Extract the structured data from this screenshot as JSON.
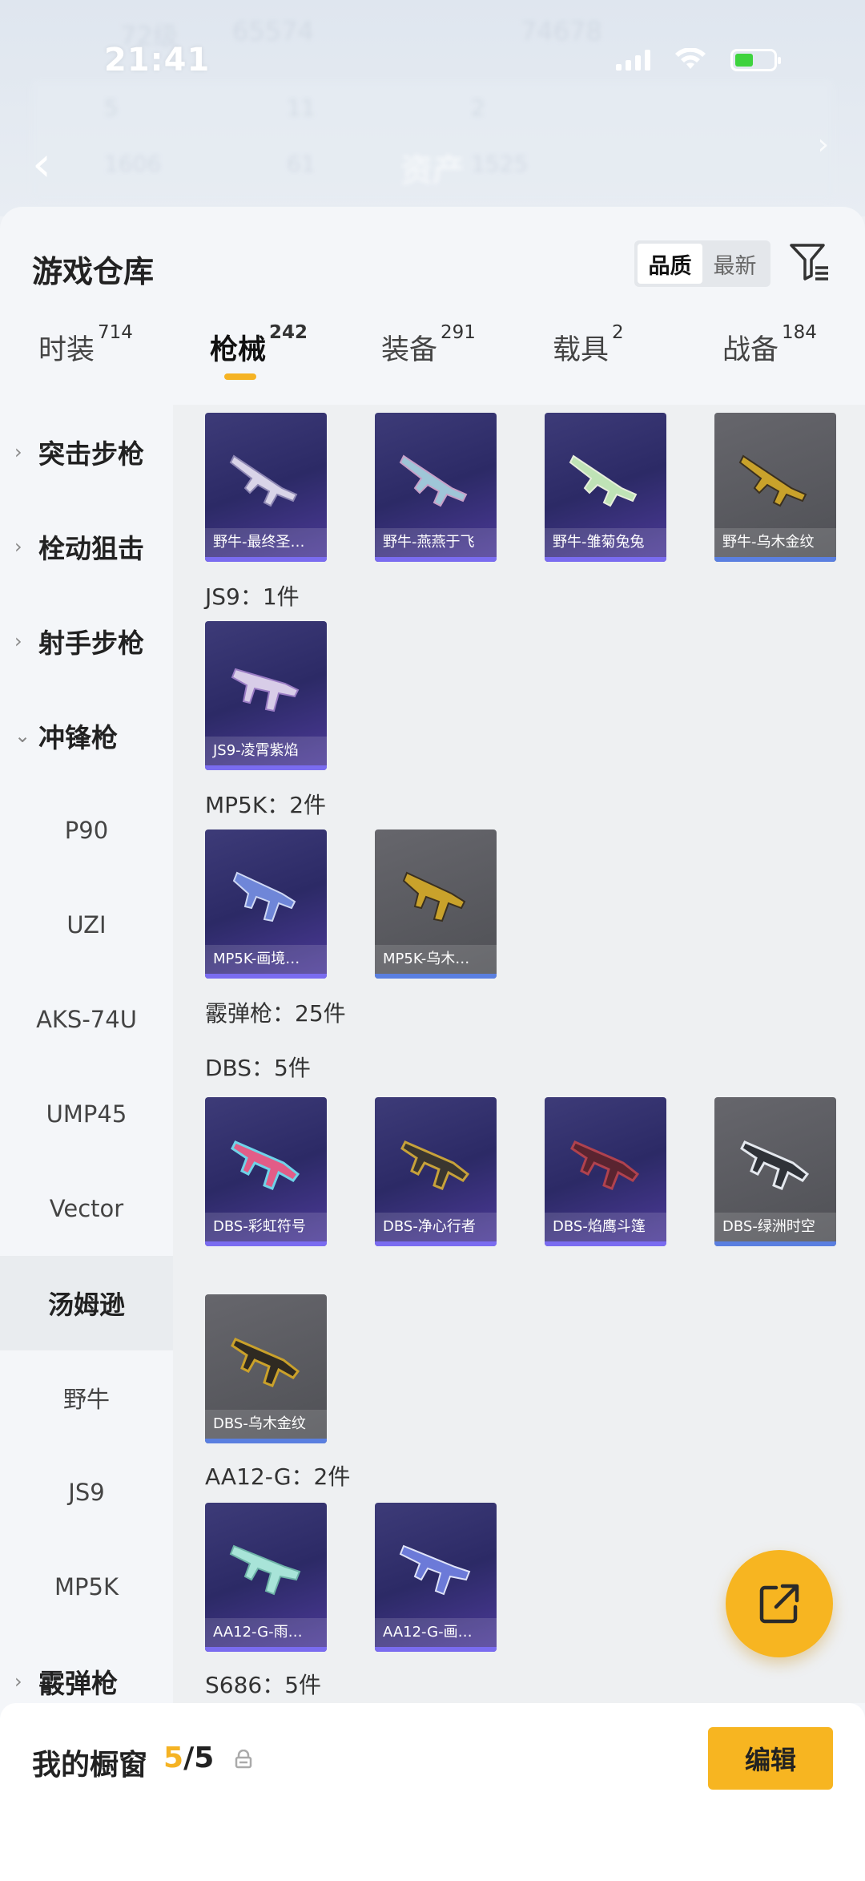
{
  "status_bar": {
    "time": "21:41"
  },
  "background": {
    "player_level": "72级",
    "score_1": "65574",
    "score_2": "74678",
    "stats": [
      "5",
      "11",
      "2",
      "1606",
      "61",
      "1525"
    ],
    "asset_label": "资产"
  },
  "sheet": {
    "title": "游戏仓库",
    "sort": {
      "options": [
        "品质",
        "最新"
      ],
      "active": "品质"
    }
  },
  "tabs": [
    {
      "label": "时装",
      "count": "714"
    },
    {
      "label": "枪械",
      "count": "242",
      "active": true
    },
    {
      "label": "装备",
      "count": "291"
    },
    {
      "label": "载具",
      "count": "2"
    },
    {
      "label": "战备",
      "count": "184"
    }
  ],
  "side_nav": [
    {
      "label": "突击步枪",
      "type": "parent",
      "expanded": false
    },
    {
      "label": "栓动狙击",
      "type": "parent",
      "expanded": false
    },
    {
      "label": "射手步枪",
      "type": "parent",
      "expanded": false
    },
    {
      "label": "冲锋枪",
      "type": "parent",
      "expanded": true
    },
    {
      "label": "P90",
      "type": "child"
    },
    {
      "label": "UZI",
      "type": "child"
    },
    {
      "label": "AKS-74U",
      "type": "child"
    },
    {
      "label": "UMP45",
      "type": "child"
    },
    {
      "label": "Vector",
      "type": "child"
    },
    {
      "label": "汤姆逊",
      "type": "child",
      "selected": true
    },
    {
      "label": "野牛",
      "type": "child"
    },
    {
      "label": "JS9",
      "type": "child"
    },
    {
      "label": "MP5K",
      "type": "child"
    },
    {
      "label": "霰弹枪",
      "type": "parent",
      "expanded": false
    }
  ],
  "groups": {
    "row1": [
      "野牛-最终圣…",
      "野牛-燕燕于飞",
      "野牛-雏菊兔兔",
      "野牛-乌木金纹"
    ],
    "js9": {
      "label": "JS9：1件",
      "items": [
        "JS9-凌霄紫焰"
      ]
    },
    "mp5k": {
      "label": "MP5K：2件",
      "items": [
        "MP5K-画境…",
        "MP5K-乌木…"
      ]
    },
    "shotgun": {
      "label": "霰弹枪：25件"
    },
    "dbs": {
      "label": "DBS：5件",
      "items": [
        "DBS-彩虹符号",
        "DBS-净心行者",
        "DBS-焰鹰斗篷",
        "DBS-绿洲时空",
        "DBS-乌木金纹"
      ]
    },
    "aa12": {
      "label": "AA12-G：2件",
      "items": [
        "AA12-G-雨…",
        "AA12-G-画…"
      ]
    },
    "s686": {
      "label": "S686：5件"
    }
  },
  "bottom": {
    "title": "我的橱窗",
    "count_current": "5",
    "count_sep": "/",
    "count_total": "5",
    "edit_label": "编辑"
  },
  "colors": {
    "accent": "#f7b521",
    "epic": "#3d3b78",
    "legendary_gray": "#5a5a60"
  }
}
